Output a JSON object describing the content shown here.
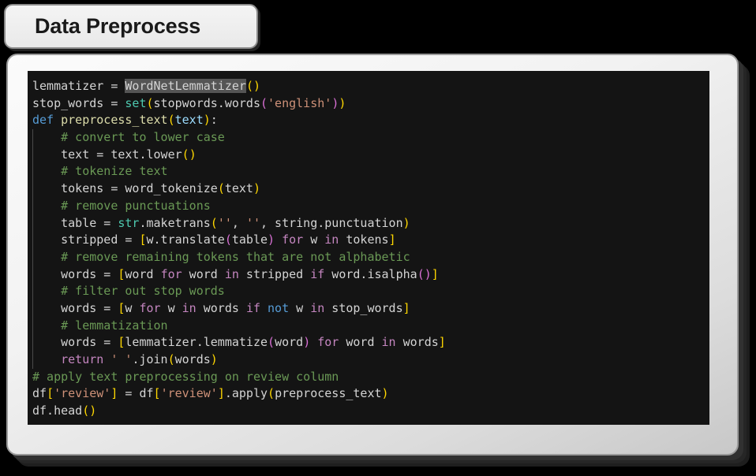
{
  "title": {
    "label": "Data Preprocess"
  },
  "colors": {
    "page_background": "#000000",
    "card_background": "#f2f2f2",
    "card_border": "#9a9a9a",
    "code_background": "#141414",
    "code_default_text": "#d4d4d4",
    "keyword": "#569cd6",
    "control_keyword": "#c586c0",
    "function": "#dcdcaa",
    "type": "#4ec9b0",
    "variable": "#9cdcfe",
    "string": "#ce9178",
    "comment": "#6a9955",
    "bracket_gold": "#ffd700",
    "bracket_pink": "#da70d6",
    "bracket_blue": "#179fff",
    "selection_highlight": "#555555"
  },
  "code": {
    "language": "python",
    "selected_text": "WordNetLemmatizer",
    "lines": [
      "lemmatizer = WordNetLemmatizer()",
      "stop_words = set(stopwords.words('english'))",
      "def preprocess_text(text):",
      "    # convert to lower case",
      "    text = text.lower()",
      "    # tokenize text",
      "    tokens = word_tokenize(text)",
      "    # remove punctuations",
      "    table = str.maketrans('', '', string.punctuation)",
      "    stripped = [w.translate(table) for w in tokens]",
      "    # remove remaining tokens that are not alphabetic",
      "    words = [word for word in stripped if word.isalpha()]",
      "    # filter out stop words",
      "    words = [w for w in words if not w in stop_words]",
      "    # lemmatization",
      "    words = [lemmatizer.lemmatize(word) for word in words]",
      "    return ' '.join(words)",
      "# apply text preprocessing on review column",
      "df['review'] = df['review'].apply(preprocess_text)",
      "df.head()"
    ],
    "tokens": [
      [
        {
          "t": "lemmatizer ",
          "c": "t-plain"
        },
        {
          "t": "= ",
          "c": "t-plain"
        },
        {
          "t": "WordNetLemmatizer",
          "c": "t-sel"
        },
        {
          "t": "(",
          "c": "t-p1"
        },
        {
          "t": ")",
          "c": "t-p1"
        }
      ],
      [
        {
          "t": "stop_words ",
          "c": "t-plain"
        },
        {
          "t": "= ",
          "c": "t-plain"
        },
        {
          "t": "set",
          "c": "t-type"
        },
        {
          "t": "(",
          "c": "t-p1"
        },
        {
          "t": "stopwords.words",
          "c": "t-plain"
        },
        {
          "t": "(",
          "c": "t-p2"
        },
        {
          "t": "'english'",
          "c": "t-str"
        },
        {
          "t": ")",
          "c": "t-p2"
        },
        {
          "t": ")",
          "c": "t-p1"
        }
      ],
      [
        {
          "t": "def ",
          "c": "t-kw"
        },
        {
          "t": "preprocess_text",
          "c": "t-fn"
        },
        {
          "t": "(",
          "c": "t-p1"
        },
        {
          "t": "text",
          "c": "t-var"
        },
        {
          "t": ")",
          "c": "t-p1"
        },
        {
          "t": ":",
          "c": "t-plain"
        }
      ],
      [
        {
          "t": "    ",
          "c": "t-plain"
        },
        {
          "t": "# convert to lower case",
          "c": "t-comment"
        }
      ],
      [
        {
          "t": "    text = text.lower",
          "c": "t-plain"
        },
        {
          "t": "(",
          "c": "t-p1"
        },
        {
          "t": ")",
          "c": "t-p1"
        }
      ],
      [
        {
          "t": "    ",
          "c": "t-plain"
        },
        {
          "t": "# tokenize text",
          "c": "t-comment"
        }
      ],
      [
        {
          "t": "    tokens = word_tokenize",
          "c": "t-plain"
        },
        {
          "t": "(",
          "c": "t-p1"
        },
        {
          "t": "text",
          "c": "t-plain"
        },
        {
          "t": ")",
          "c": "t-p1"
        }
      ],
      [
        {
          "t": "    ",
          "c": "t-plain"
        },
        {
          "t": "# remove punctuations",
          "c": "t-comment"
        }
      ],
      [
        {
          "t": "    table = ",
          "c": "t-plain"
        },
        {
          "t": "str",
          "c": "t-type"
        },
        {
          "t": ".maketrans",
          "c": "t-plain"
        },
        {
          "t": "(",
          "c": "t-p1"
        },
        {
          "t": "''",
          "c": "t-str"
        },
        {
          "t": ", ",
          "c": "t-plain"
        },
        {
          "t": "''",
          "c": "t-str"
        },
        {
          "t": ", string.punctuation",
          "c": "t-plain"
        },
        {
          "t": ")",
          "c": "t-p1"
        }
      ],
      [
        {
          "t": "    stripped = ",
          "c": "t-plain"
        },
        {
          "t": "[",
          "c": "t-p1"
        },
        {
          "t": "w.translate",
          "c": "t-plain"
        },
        {
          "t": "(",
          "c": "t-p2"
        },
        {
          "t": "table",
          "c": "t-plain"
        },
        {
          "t": ")",
          "c": "t-p2"
        },
        {
          "t": " ",
          "c": "t-plain"
        },
        {
          "t": "for",
          "c": "t-ctrl"
        },
        {
          "t": " w ",
          "c": "t-plain"
        },
        {
          "t": "in",
          "c": "t-ctrl"
        },
        {
          "t": " tokens",
          "c": "t-plain"
        },
        {
          "t": "]",
          "c": "t-p1"
        }
      ],
      [
        {
          "t": "    ",
          "c": "t-plain"
        },
        {
          "t": "# remove remaining tokens that are not alphabetic",
          "c": "t-comment"
        }
      ],
      [
        {
          "t": "    words = ",
          "c": "t-plain"
        },
        {
          "t": "[",
          "c": "t-p1"
        },
        {
          "t": "word ",
          "c": "t-plain"
        },
        {
          "t": "for",
          "c": "t-ctrl"
        },
        {
          "t": " word ",
          "c": "t-plain"
        },
        {
          "t": "in",
          "c": "t-ctrl"
        },
        {
          "t": " stripped ",
          "c": "t-plain"
        },
        {
          "t": "if",
          "c": "t-ctrl"
        },
        {
          "t": " word.isalpha",
          "c": "t-plain"
        },
        {
          "t": "(",
          "c": "t-p2"
        },
        {
          "t": ")",
          "c": "t-p2"
        },
        {
          "t": "]",
          "c": "t-p1"
        }
      ],
      [
        {
          "t": "    ",
          "c": "t-plain"
        },
        {
          "t": "# filter out stop words",
          "c": "t-comment"
        }
      ],
      [
        {
          "t": "    words = ",
          "c": "t-plain"
        },
        {
          "t": "[",
          "c": "t-p1"
        },
        {
          "t": "w ",
          "c": "t-plain"
        },
        {
          "t": "for",
          "c": "t-ctrl"
        },
        {
          "t": " w ",
          "c": "t-plain"
        },
        {
          "t": "in",
          "c": "t-ctrl"
        },
        {
          "t": " words ",
          "c": "t-plain"
        },
        {
          "t": "if",
          "c": "t-ctrl"
        },
        {
          "t": " ",
          "c": "t-plain"
        },
        {
          "t": "not",
          "c": "t-kw"
        },
        {
          "t": " w ",
          "c": "t-plain"
        },
        {
          "t": "in",
          "c": "t-ctrl"
        },
        {
          "t": " stop_words",
          "c": "t-plain"
        },
        {
          "t": "]",
          "c": "t-p1"
        }
      ],
      [
        {
          "t": "    ",
          "c": "t-plain"
        },
        {
          "t": "# lemmatization",
          "c": "t-comment"
        }
      ],
      [
        {
          "t": "    words = ",
          "c": "t-plain"
        },
        {
          "t": "[",
          "c": "t-p1"
        },
        {
          "t": "lemmatizer.lemmatize",
          "c": "t-plain"
        },
        {
          "t": "(",
          "c": "t-p2"
        },
        {
          "t": "word",
          "c": "t-plain"
        },
        {
          "t": ")",
          "c": "t-p2"
        },
        {
          "t": " ",
          "c": "t-plain"
        },
        {
          "t": "for",
          "c": "t-ctrl"
        },
        {
          "t": " word ",
          "c": "t-plain"
        },
        {
          "t": "in",
          "c": "t-ctrl"
        },
        {
          "t": " words",
          "c": "t-plain"
        },
        {
          "t": "]",
          "c": "t-p1"
        }
      ],
      [
        {
          "t": "    ",
          "c": "t-plain"
        },
        {
          "t": "return",
          "c": "t-ctrl"
        },
        {
          "t": " ",
          "c": "t-plain"
        },
        {
          "t": "' '",
          "c": "t-str"
        },
        {
          "t": ".join",
          "c": "t-plain"
        },
        {
          "t": "(",
          "c": "t-p1"
        },
        {
          "t": "words",
          "c": "t-plain"
        },
        {
          "t": ")",
          "c": "t-p1"
        }
      ],
      [
        {
          "t": "# apply text preprocessing on review column",
          "c": "t-comment"
        }
      ],
      [
        {
          "t": "df",
          "c": "t-plain"
        },
        {
          "t": "[",
          "c": "t-p1"
        },
        {
          "t": "'review'",
          "c": "t-str"
        },
        {
          "t": "]",
          "c": "t-p1"
        },
        {
          "t": " = df",
          "c": "t-plain"
        },
        {
          "t": "[",
          "c": "t-p1"
        },
        {
          "t": "'review'",
          "c": "t-str"
        },
        {
          "t": "]",
          "c": "t-p1"
        },
        {
          "t": ".apply",
          "c": "t-plain"
        },
        {
          "t": "(",
          "c": "t-p1"
        },
        {
          "t": "preprocess_text",
          "c": "t-plain"
        },
        {
          "t": ")",
          "c": "t-p1"
        }
      ],
      [
        {
          "t": "df.head",
          "c": "t-plain"
        },
        {
          "t": "(",
          "c": "t-p1"
        },
        {
          "t": ")",
          "c": "t-p1"
        }
      ]
    ],
    "indented_flags": [
      false,
      false,
      false,
      true,
      true,
      true,
      true,
      true,
      true,
      true,
      true,
      true,
      true,
      true,
      true,
      true,
      true,
      false,
      false,
      false
    ]
  }
}
